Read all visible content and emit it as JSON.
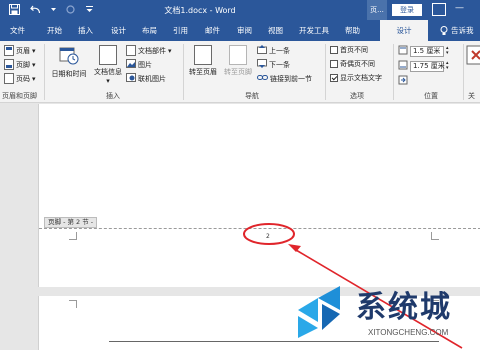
{
  "titlebar": {
    "title": "文档1.docx - Word",
    "context_tab_label": "页...",
    "login": "登录",
    "window_controls": "—"
  },
  "tabs": [
    "文件",
    "开始",
    "插入",
    "设计",
    "布局",
    "引用",
    "邮件",
    "审阅",
    "视图",
    "开发工具",
    "帮助"
  ],
  "active_tab": "设计",
  "tell_me": "告诉我",
  "ribbon": {
    "header_footer": {
      "header": "页眉",
      "footer": "页脚",
      "page_number": "页码",
      "group_label": "页眉和页脚"
    },
    "insert": {
      "date_time": "日期和时间",
      "doc_info": "文档信息",
      "quick_parts": "文档部件",
      "pictures": "图片",
      "online_pictures": "联机图片",
      "group_label": "插入"
    },
    "navigation": {
      "goto_header": "转至页眉",
      "goto_footer": "转至页脚",
      "previous": "上一条",
      "next": "下一条",
      "link_previous": "链接到前一节",
      "group_label": "导航"
    },
    "options": {
      "different_first": "首页不同",
      "different_odd_even": "奇偶页不同",
      "show_doc_text": "显示文档文字",
      "different_first_checked": false,
      "different_odd_even_checked": false,
      "show_doc_text_checked": true,
      "group_label": "选项"
    },
    "position": {
      "header_from_top": "1.5 厘米",
      "footer_from_bottom": "1.75 厘米",
      "group_label": "位置"
    },
    "close_label": "关"
  },
  "document": {
    "footer_tag": "页脚 - 第 2 节 -",
    "page_number": "2"
  },
  "watermark": {
    "text": "系统城",
    "sub": "XITONGCHENG.COM"
  },
  "colors": {
    "accent": "#2b579a",
    "annotation": "#e0252b"
  }
}
